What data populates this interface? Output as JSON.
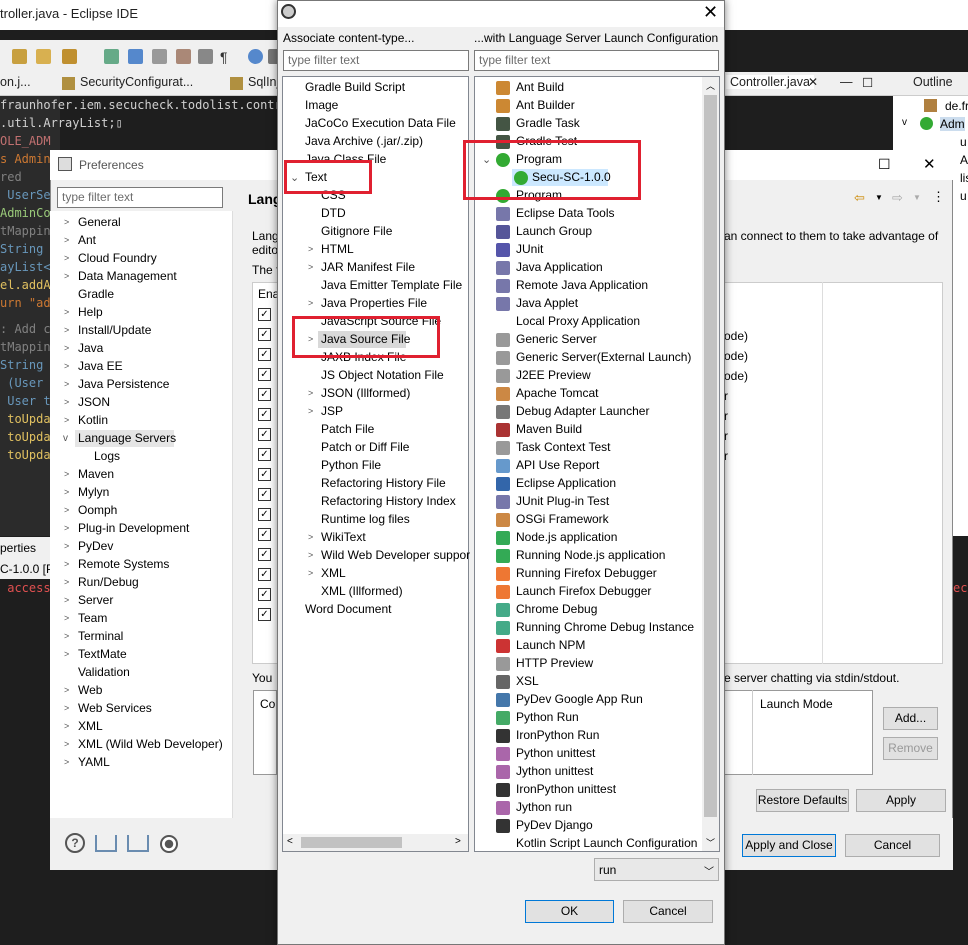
{
  "eclipse": {
    "title": "troller.java - Eclipse IDE",
    "tabs": [
      "on.j...",
      "SecurityConfigurat...",
      "SqlInjec",
      "Controller.java",
      "Outline"
    ],
    "outline_items": [
      "de.fr",
      "Adm",
      "u",
      "A",
      "lis",
      "u"
    ],
    "code_lines": [
      {
        "text": "fraunhofer.iem.secucheck.todolist.contro",
        "color": "#d0d0d0"
      },
      {
        "text": ".util.ArrayList;▯",
        "color": "#d0d0d0"
      },
      {
        "text": "OLE_ADM",
        "color": "#c07070"
      },
      {
        "text": "s Admin",
        "color": "#cc7832"
      },
      {
        "text": "red",
        "color": "#808080"
      },
      {
        "text": " UserSe",
        "color": "#6897bb"
      },
      {
        "text": "AdminCo",
        "color": "#9aca7a"
      },
      {
        "text": "tMappin",
        "color": "#808080"
      },
      {
        "text": "String",
        "color": "#6897bb"
      },
      {
        "text": "ayList<",
        "color": "#6897bb"
      },
      {
        "text": "el.addA",
        "color": "#e0c060"
      },
      {
        "text": "urn \"ad",
        "color": "#cc7832"
      },
      {
        "text": ": Add c",
        "color": "#808080"
      },
      {
        "text": "tMappin",
        "color": "#808080"
      },
      {
        "text": "String",
        "color": "#6897bb"
      },
      {
        "text": " (User",
        "color": "#6897bb"
      },
      {
        "text": " User t",
        "color": "#6897bb"
      },
      {
        "text": " toUpda",
        "color": "#e0c060"
      },
      {
        "text": " toUpda",
        "color": "#e0c060"
      },
      {
        "text": " toUpda",
        "color": "#e0c060"
      }
    ],
    "bottom_tab": "perties",
    "bottom_line": "C-1.0.0 [P",
    "console_text": " access",
    "console_right": "ec"
  },
  "preferences": {
    "title": "Preferences",
    "filter_placeholder": "type filter text",
    "heading": "Lang",
    "items": [
      "General",
      "Ant",
      "Cloud Foundry",
      "Data Management",
      "Gradle",
      "Help",
      "Install/Update",
      "Java",
      "Java EE",
      "Java Persistence",
      "JSON",
      "Kotlin",
      "Language Servers",
      "Logs",
      "Maven",
      "Mylyn",
      "Oomph",
      "Plug-in Development",
      "PyDev",
      "Remote Systems",
      "Run/Debug",
      "Server",
      "Team",
      "Terminal",
      "TextMate",
      "Validation",
      "Web",
      "Web Services",
      "XML",
      "XML (Wild Web Developer)",
      "YAML"
    ],
    "desc_line1": "Lang",
    "desc_line2": "edito",
    "desc_line3": "The f",
    "desc_right": "an connect to them to take advantage of",
    "col_enable": "Ena",
    "mode_texts": [
      "ode)",
      "ode)",
      "ode)",
      "r",
      "r",
      "r",
      "r"
    ],
    "bottom_left": "You",
    "bottom_right": "e server chatting via stdin/stdout.",
    "co_label": "Co",
    "launch_mode_header": "Launch Mode",
    "btn_add": "Add...",
    "btn_remove": "Remove",
    "btn_restore": "Restore Defaults",
    "btn_apply": "Apply",
    "btn_apply_close": "Apply and Close",
    "btn_cancel": "Cancel"
  },
  "dialog": {
    "left_header": "Associate content-type...",
    "right_header": "...with Language Server Launch Configuration",
    "left_filter_placeholder": "type filter text",
    "right_filter_placeholder": "type filter text",
    "content_types": [
      "Gradle Build Script",
      "Image",
      "JaCoCo Execution Data File",
      "Java Archive (.jar/.zip)",
      "Java Class File",
      "Text",
      "CSS",
      "DTD",
      "Gitignore File",
      "HTML",
      "JAR Manifest File",
      "Java Emitter Template File",
      "Java Properties File",
      "JavaScript Source File",
      "Java Source File",
      "JAXB Index File",
      "JS Object Notation File",
      "JSON (Illformed)",
      "JSP",
      "Patch File",
      "Patch or Diff File",
      "Python File",
      "Refactoring History File",
      "Refactoring History Index",
      "Runtime log files",
      "WikiText",
      "Wild Web Developer suppor",
      "XML",
      "XML (Illformed)",
      "Word Document"
    ],
    "launch_configs": [
      "Ant Build",
      "Ant Builder",
      "Gradle Task",
      "Gradle Test",
      "Program",
      "Secu-SC-1.0.0",
      "Program",
      "Eclipse Data Tools",
      "Launch Group",
      "JUnit",
      "Java Application",
      "Remote Java Application",
      "Java Applet",
      "Local Proxy Application",
      "Generic Server",
      "Generic Server(External Launch)",
      "J2EE Preview",
      "Apache Tomcat",
      "Debug Adapter Launcher",
      "Maven Build",
      "Task Context Test",
      "API Use Report",
      "Eclipse Application",
      "JUnit Plug-in Test",
      "OSGi Framework",
      "Node.js application",
      "Running Node.js application",
      "Running Firefox Debugger",
      "Launch Firefox Debugger",
      "Chrome Debug",
      "Running Chrome Debug Instance",
      "Launch NPM",
      "HTTP Preview",
      "XSL",
      "PyDev Google App Run",
      "Python Run",
      "IronPython Run",
      "Python unittest",
      "Jython unittest",
      "IronPython unittest",
      "Jython run",
      "PyDev Django",
      "Kotlin Script Launch Configuration"
    ],
    "mode_value": "run",
    "ok": "OK",
    "cancel": "Cancel"
  },
  "colors": {
    "highlight": "#e02030",
    "selection": "#cce8ff",
    "accent": "#0078d7"
  }
}
